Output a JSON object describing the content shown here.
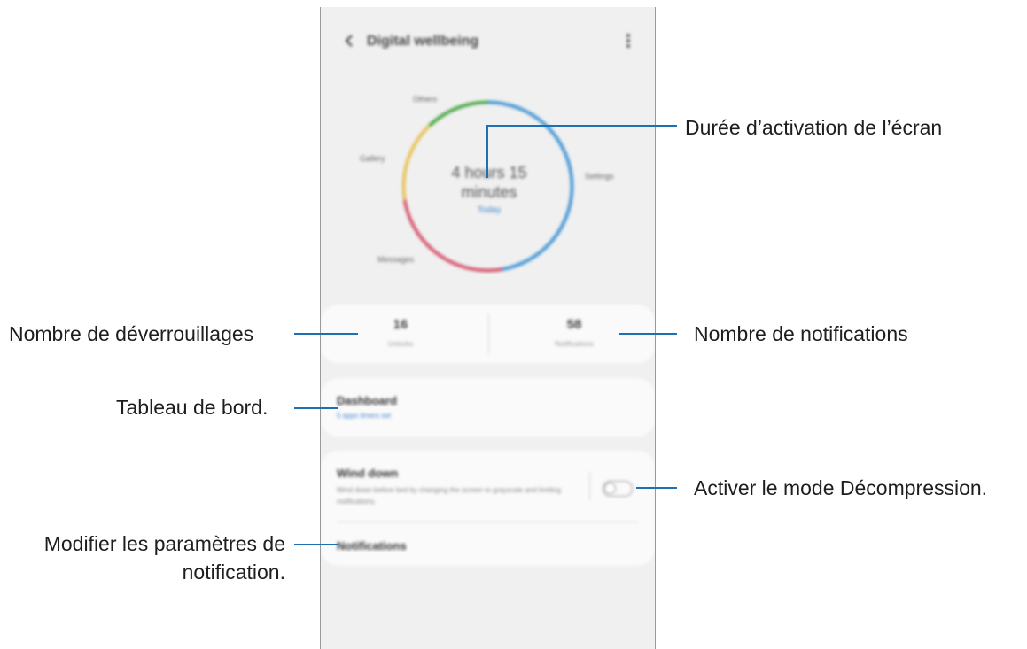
{
  "screen": {
    "app_title": "Digital wellbeing",
    "usage_time": "4 hours 15 minutes",
    "usage_period": "Today",
    "app_labels": [
      "Others",
      "Gallery",
      "Messages",
      "Settings"
    ],
    "unlocks": {
      "value": "16",
      "label": "Unlocks"
    },
    "notifications": {
      "value": "58",
      "label": "Notifications"
    },
    "dashboard": {
      "title": "Dashboard",
      "subtitle": "5 apps timers set"
    },
    "wind_down": {
      "title": "Wind down",
      "description": "Wind down before bed by changing the screen to grayscale and limiting notifications."
    },
    "notifications_item": {
      "title": "Notifications"
    },
    "ring_colors": {
      "blue": "#4a9ad6",
      "green": "#4daa4a",
      "yellow": "#e8c25a",
      "red": "#d65c72"
    }
  },
  "callouts": {
    "screen_time": "Durée d’activation de l’écran",
    "unlocks": "Nombre de déverrouillages",
    "notifications": "Nombre de notifications",
    "dashboard": "Tableau de bord.",
    "wind_down": "Activer le mode Décompression.",
    "notification_settings_line1": "Modifier les paramètres de",
    "notification_settings_line2": "notification."
  }
}
